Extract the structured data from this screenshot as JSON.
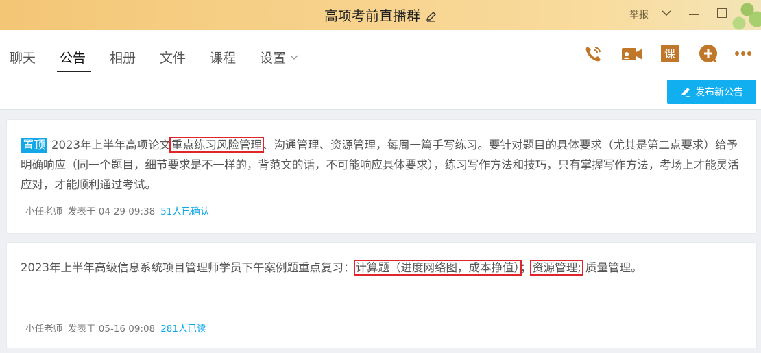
{
  "window": {
    "title": "高项考前直播群",
    "report_label": "举报"
  },
  "tabs": [
    {
      "label": "聊天"
    },
    {
      "label": "公告"
    },
    {
      "label": "相册"
    },
    {
      "label": "文件"
    },
    {
      "label": "课程"
    },
    {
      "label": "设置"
    }
  ],
  "active_tab": "公告",
  "toolbar": {
    "icons": [
      "phone-icon",
      "video-call-icon",
      "course-icon",
      "add-icon",
      "more-icon"
    ],
    "course_icon_glyph": "课",
    "publish_label": "发布新公告"
  },
  "accent_colors": {
    "brand_blue": "#12a8e8",
    "highlight_red": "#e0252b",
    "icon_orange": "#c0772a"
  },
  "announcements": [
    {
      "pinned_label": "置顶",
      "text_before": "2023年上半年高项论文",
      "highlight": "重点练习风险管理",
      "text_after": "、沟通管理、资源管理，每周一篇手写练习。要针对题目的具体要求（尤其是第二点要求）给予明确响应（同一个题目，细节要求是不一样的，背范文的话，不可能响应具体要求），练习写作方法和技巧，只有掌握写作方法，考场上才能灵活应对，才能顺利通过考试。",
      "author": "小任老师",
      "posted": "发表于 04-29 09:38",
      "status": "51人已确认"
    },
    {
      "text_before": "2023年上半年高级信息系统项目管理师学员下午案例题重点复习：",
      "highlight1": "计算题（进度网络图，成本挣值）",
      "separator": "；",
      "highlight2": "资源管理;",
      "text_after": " 质量管理。",
      "author": "小任老师",
      "posted": "发表于 05-16 09:08",
      "status": "281人已读"
    }
  ]
}
